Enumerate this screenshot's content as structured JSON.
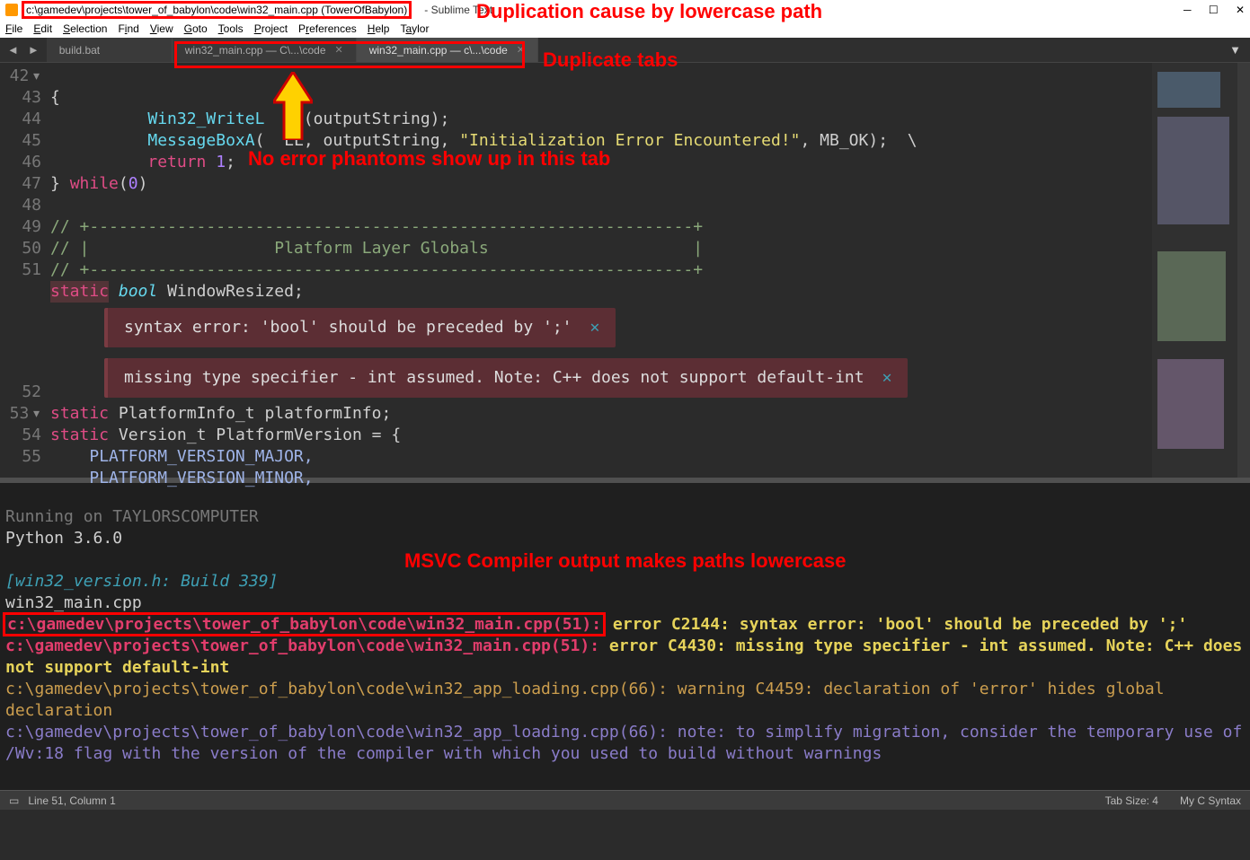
{
  "title": "c:\\gamedev\\projects\\tower_of_babylon\\code\\win32_main.cpp (TowerOfBabylon)",
  "app_suffix": "- Sublime Text",
  "menu": [
    "File",
    "Edit",
    "Selection",
    "Find",
    "View",
    "Goto",
    "Tools",
    "Project",
    "Preferences",
    "Help",
    "Taylor"
  ],
  "tabs": [
    {
      "label": "build.bat",
      "active": false
    },
    {
      "label": "win32_main.cpp — C\\...\\code",
      "active": false
    },
    {
      "label": "win32_main.cpp — c\\...\\code",
      "active": true
    }
  ],
  "annotations": {
    "dup_cause": "Duplication cause by lowercase path",
    "dup_tabs": "Duplicate tabs",
    "no_phantoms": "No error phantoms show up in this tab",
    "msvc_lower": "MSVC Compiler output makes paths lowercase"
  },
  "code": {
    "lines": {
      "42": "{",
      "43a": "Win32_WriteL",
      "43b": "e",
      "43c": "(outputString);",
      "44a": "MessageBoxA",
      "44b": "(",
      "44c": "LL",
      "44d": ", outputString, ",
      "44e": "\"Initialization Error Encountered!\"",
      "44f": ", MB_OK);  \\",
      "45a": "return",
      "45b": "1",
      "46a": "} ",
      "46b": "while",
      "46c": "(",
      "46d": "0",
      "46e": ")",
      "47": "",
      "48": "// +--------------------------------------------------------------+",
      "49": "// |                   Platform Layer Globals                     |",
      "50": "// +--------------------------------------------------------------+",
      "51a": "static",
      "51b": "bool",
      "51c": "WindowResized;",
      "52a": "static",
      "52b": "PlatformInfo_t",
      "52c": "platformInfo;",
      "53a": "static",
      "53b": "Version_t",
      "53c": "PlatformVersion = {",
      "54": "PLATFORM_VERSION_MAJOR,",
      "55": "PLATFORM_VERSION_MINOR,"
    },
    "gutter": [
      "42",
      "43",
      "44",
      "45",
      "46",
      "47",
      "48",
      "49",
      "50",
      "51",
      "52",
      "53",
      "54",
      "55"
    ]
  },
  "phantoms": [
    "syntax error: 'bool' should be preceded by ';'",
    "missing type specifier - int assumed. Note: C++ does not support default-int"
  ],
  "panel": {
    "l0": "Running on TAYLORSCOMPUTER",
    "l1": "Python 3.6.0",
    "l2": "[win32_version.h: Build 339]",
    "l3": "win32_main.cpp",
    "l4p": "c:\\gamedev\\projects\\tower_of_babylon\\code\\win32_main.cpp(51):",
    "l4e": " error C2144: syntax error: 'bool' should be preceded by ';'",
    "l5p": "c:\\gamedev\\projects\\tower_of_babylon\\code\\win32_main.cpp(51):",
    "l5e": " error C4430: missing type specifier - int assumed. Note: C++ does not support default-int",
    "l6p": "c:\\gamedev\\projects\\tower_of_babylon\\code\\win32_app_loading.cpp(66):",
    "l6e": " warning C4459: declaration of 'error' hides global declaration",
    "l7p": "c:\\gamedev\\projects\\tower_of_babylon\\code\\win32_app_loading.cpp(66):",
    "l7e": " note: to simplify migration, consider the temporary use of /Wv:18 flag with the version of the compiler with which you used to build without warnings"
  },
  "status": {
    "pos": "Line 51, Column 1",
    "tab": "Tab Size: 4",
    "syntax": "My C Syntax"
  }
}
